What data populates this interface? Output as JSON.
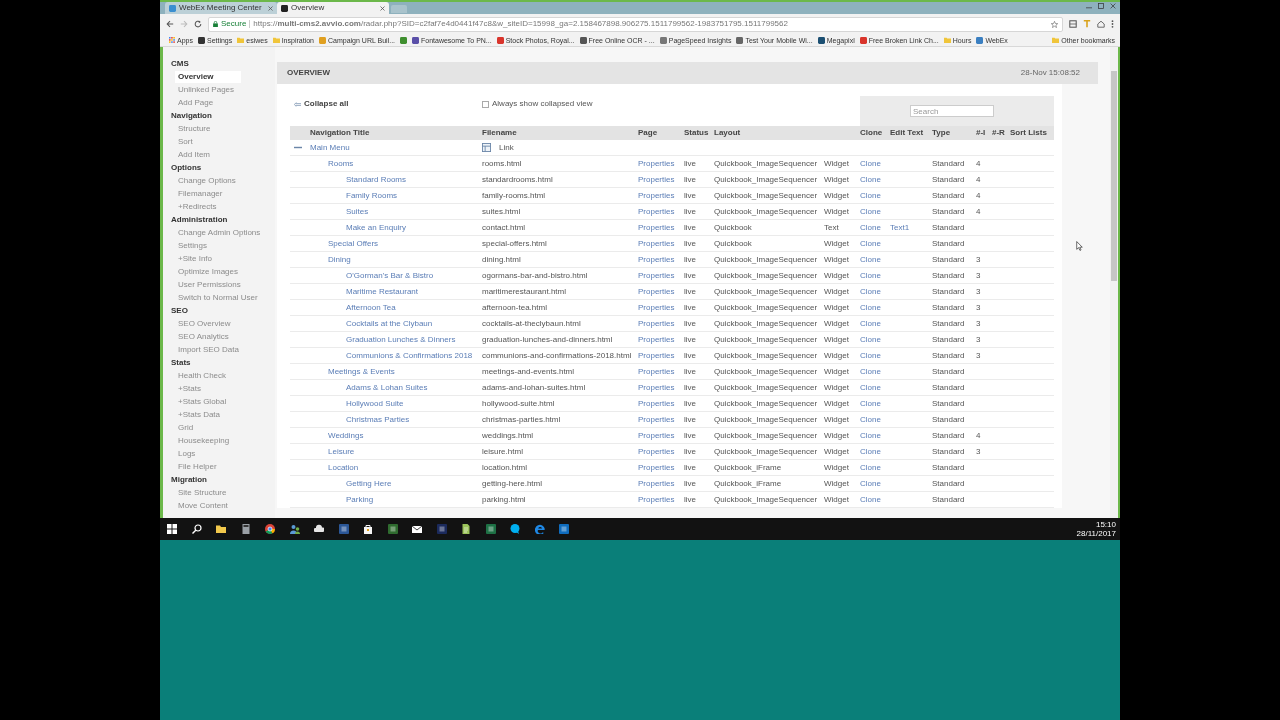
{
  "browser": {
    "tabs": [
      {
        "title": "WebEx Meeting Center",
        "selected": false,
        "color": "#3b8fd0"
      },
      {
        "title": "Overview",
        "selected": true,
        "color": "#222222"
      }
    ],
    "address_bar": {
      "secure_label": "Secure",
      "url": "https://**multi-cms2.avvio.com**/radar.php?SID=c2faf7e4d0441f47c8&w_siteID=15998_ga=2.158467898.906275.1511799562-1983751795.1511799562"
    },
    "bookmarks": [
      {
        "kind": "apps",
        "label": "Apps"
      },
      {
        "kind": "site",
        "label": "Settings",
        "color": "#333333"
      },
      {
        "kind": "folder",
        "label": "esiwes"
      },
      {
        "kind": "folder",
        "label": "Inspiration"
      },
      {
        "kind": "site",
        "label": "Campaign URL Buil...",
        "color": "#e0a020"
      },
      {
        "kind": "site",
        "color": "#3f8f2f"
      },
      {
        "kind": "site",
        "label": "Fontawesome To PN...",
        "color": "#5a4fa8"
      },
      {
        "kind": "site",
        "label": "Stock Photos, Royal...",
        "color": "#d9342b"
      },
      {
        "kind": "site",
        "label": "Free Online OCR - ...",
        "color": "#555555"
      },
      {
        "kind": "site",
        "label": "PageSpeed Insights",
        "color": "#777777"
      },
      {
        "kind": "site",
        "label": "Test Your Mobile Wi...",
        "color": "#666666"
      },
      {
        "kind": "site",
        "label": "Megapixl",
        "color": "#1b4f72"
      },
      {
        "kind": "site",
        "label": "Free Broken Link Ch...",
        "color": "#d9342b"
      },
      {
        "kind": "folder",
        "label": "Hours"
      },
      {
        "kind": "site",
        "label": "WebEx",
        "color": "#3a7fc1"
      }
    ],
    "other_bookmarks": {
      "label": "Other bookmarks"
    }
  },
  "sidebar": {
    "sections": [
      {
        "title": "CMS",
        "items": [
          {
            "label": "Overview",
            "selected": true
          },
          {
            "label": "Unlinked Pages",
            "selected": false
          },
          {
            "label": "Add Page",
            "selected": false
          }
        ]
      },
      {
        "title": "Navigation",
        "items": [
          {
            "label": "Structure",
            "selected": false
          },
          {
            "label": "Sort",
            "selected": false
          },
          {
            "label": "Add Item",
            "selected": false
          }
        ]
      },
      {
        "title": "Options",
        "items": [
          {
            "label": "Change Options",
            "selected": false
          },
          {
            "label": "Filemanager",
            "selected": false
          },
          {
            "label": "+Redirects",
            "selected": false
          }
        ]
      },
      {
        "title": "Administration",
        "items": [
          {
            "label": "Change Admin Options",
            "selected": false
          },
          {
            "label": "Settings",
            "selected": false
          },
          {
            "label": "+Site Info",
            "selected": false
          },
          {
            "label": "Optimize Images",
            "selected": false
          },
          {
            "label": "User Permissions",
            "selected": false
          },
          {
            "label": "Switch to Normal User",
            "selected": false
          }
        ]
      },
      {
        "title": "SEO",
        "items": [
          {
            "label": "SEO Overview",
            "selected": false
          },
          {
            "label": "SEO Analytics",
            "selected": false
          },
          {
            "label": "Import SEO Data",
            "selected": false
          }
        ]
      },
      {
        "title": "Stats",
        "items": [
          {
            "label": "Health Check",
            "selected": false
          },
          {
            "label": "+Stats",
            "selected": false
          },
          {
            "label": "+Stats Global",
            "selected": false
          },
          {
            "label": "+Stats Data",
            "selected": false
          },
          {
            "label": "Grid",
            "selected": false
          },
          {
            "label": "Housekeeping",
            "selected": false
          },
          {
            "label": "Logs",
            "selected": false
          },
          {
            "label": "File Helper",
            "selected": false
          }
        ]
      },
      {
        "title": "Migration",
        "items": [
          {
            "label": "Site Structure",
            "selected": false
          },
          {
            "label": "Move Content",
            "selected": false
          }
        ]
      }
    ]
  },
  "main": {
    "title": "OVERVIEW",
    "timestamp": "28-Nov 15:08:52",
    "collapse_all": "Collapse all",
    "collapsed_view": {
      "label": "Always show collapsed view",
      "checked": false
    },
    "search": {
      "placeholder": "Search"
    }
  },
  "table": {
    "columns": [
      "Navigation Title",
      "Filename",
      "Page",
      "Status",
      "Layout",
      "Clone",
      "Edit Text",
      "Type",
      "#-I",
      "#-R",
      "Sort Lists"
    ],
    "rows": [
      {
        "kind": "link",
        "title": "Main Menu",
        "expanded": true,
        "filename": "Link",
        "children": [
          {
            "title": "Rooms",
            "filename": "rooms.html",
            "page": "Properties",
            "status": "live",
            "layout": "Quickbook_ImageSequencer",
            "column_6": "Widget",
            "clone": "Clone",
            "type": "Standard",
            "hash_i": "4",
            "children": [
              {
                "title": "Standard Rooms",
                "filename": "standardrooms.html",
                "page": "Properties",
                "status": "live",
                "layout": "Quickbook_ImageSequencer",
                "column_6": "Widget",
                "clone": "Clone",
                "type": "Standard",
                "hash_i": "4"
              },
              {
                "title": "Family Rooms",
                "filename": "family-rooms.html",
                "page": "Properties",
                "status": "live",
                "layout": "Quickbook_ImageSequencer",
                "column_6": "Widget",
                "clone": "Clone",
                "type": "Standard",
                "hash_i": "4"
              },
              {
                "title": "Suites",
                "filename": "suites.html",
                "page": "Properties",
                "status": "live",
                "layout": "Quickbook_ImageSequencer",
                "column_6": "Widget",
                "clone": "Clone",
                "type": "Standard",
                "hash_i": "4"
              },
              {
                "title": "Make an Enquiry",
                "filename": "contact.html",
                "page": "Properties",
                "status": "live",
                "layout": "Quickbook",
                "column_6": "Text",
                "clone": "Clone",
                "edit_text": "Text1",
                "type": "Standard"
              }
            ]
          },
          {
            "title": "Special Offers",
            "filename": "special-offers.html",
            "page": "Properties",
            "status": "live",
            "layout": "Quickbook",
            "column_6": "Widget",
            "clone": "Clone",
            "type": "Standard"
          },
          {
            "title": "Dining",
            "filename": "dining.html",
            "page": "Properties",
            "status": "live",
            "layout": "Quickbook_ImageSequencer",
            "column_6": "Widget",
            "clone": "Clone",
            "type": "Standard",
            "hash_i": "3",
            "children": [
              {
                "title": "O'Gorman's Bar & Bistro",
                "filename": "ogormans-bar-and-bistro.html",
                "page": "Properties",
                "status": "live",
                "layout": "Quickbook_ImageSequencer",
                "column_6": "Widget",
                "clone": "Clone",
                "type": "Standard",
                "hash_i": "3"
              },
              {
                "title": "Maritime Restaurant",
                "filename": "maritimerestaurant.html",
                "page": "Properties",
                "status": "live",
                "layout": "Quickbook_ImageSequencer",
                "column_6": "Widget",
                "clone": "Clone",
                "type": "Standard",
                "hash_i": "3"
              },
              {
                "title": "Afternoon Tea",
                "filename": "afternoon-tea.html",
                "page": "Properties",
                "status": "live",
                "layout": "Quickbook_ImageSequencer",
                "column_6": "Widget",
                "clone": "Clone",
                "type": "Standard",
                "hash_i": "3"
              },
              {
                "title": "Cocktails at the Clybaun",
                "filename": "cocktails-at-theclybaun.html",
                "page": "Properties",
                "status": "live",
                "layout": "Quickbook_ImageSequencer",
                "column_6": "Widget",
                "clone": "Clone",
                "type": "Standard",
                "hash_i": "3"
              },
              {
                "title": "Graduation Lunches & Dinners",
                "filename": "graduation-lunches-and-dinners.html",
                "page": "Properties",
                "status": "live",
                "layout": "Quickbook_ImageSequencer",
                "column_6": "Widget",
                "clone": "Clone",
                "type": "Standard",
                "hash_i": "3"
              },
              {
                "title": "Communions & Confirmations 2018",
                "filename": "communions-and-confirmations-2018.html",
                "page": "Properties",
                "status": "live",
                "layout": "Quickbook_ImageSequencer",
                "column_6": "Widget",
                "clone": "Clone",
                "type": "Standard",
                "hash_i": "3"
              }
            ]
          },
          {
            "title": "Meetings & Events",
            "filename": "meetings-and-events.html",
            "page": "Properties",
            "status": "live",
            "layout": "Quickbook_ImageSequencer",
            "column_6": "Widget",
            "clone": "Clone",
            "type": "Standard",
            "children": [
              {
                "title": "Adams & Lohan Suites",
                "filename": "adams-and-lohan-suites.html",
                "page": "Properties",
                "status": "live",
                "layout": "Quickbook_ImageSequencer",
                "column_6": "Widget",
                "clone": "Clone",
                "type": "Standard"
              },
              {
                "title": "Hollywood Suite",
                "filename": "hollywood-suite.html",
                "page": "Properties",
                "status": "live",
                "layout": "Quickbook_ImageSequencer",
                "column_6": "Widget",
                "clone": "Clone",
                "type": "Standard"
              },
              {
                "title": "Christmas Parties",
                "filename": "christmas-parties.html",
                "page": "Properties",
                "status": "live",
                "layout": "Quickbook_ImageSequencer",
                "column_6": "Widget",
                "clone": "Clone",
                "type": "Standard"
              }
            ]
          },
          {
            "title": "Weddings",
            "filename": "weddings.html",
            "page": "Properties",
            "status": "live",
            "layout": "Quickbook_ImageSequencer",
            "column_6": "Widget",
            "clone": "Clone",
            "type": "Standard",
            "hash_i": "4"
          },
          {
            "title": "Leisure",
            "filename": "leisure.html",
            "page": "Properties",
            "status": "live",
            "layout": "Quickbook_ImageSequencer",
            "column_6": "Widget",
            "clone": "Clone",
            "type": "Standard",
            "hash_i": "3"
          },
          {
            "title": "Location",
            "filename": "location.html",
            "page": "Properties",
            "status": "live",
            "layout": "Quickbook_iFrame",
            "column_6": "Widget",
            "clone": "Clone",
            "type": "Standard",
            "children": [
              {
                "title": "Getting Here",
                "filename": "getting-here.html",
                "page": "Properties",
                "status": "live",
                "layout": "Quickbook_iFrame",
                "column_6": "Widget",
                "clone": "Clone",
                "type": "Standard"
              },
              {
                "title": "Parking",
                "filename": "parking.html",
                "page": "Properties",
                "status": "live",
                "layout": "Quickbook_ImageSequencer",
                "column_6": "Widget",
                "clone": "Clone",
                "type": "Standard"
              }
            ]
          }
        ]
      }
    ]
  },
  "taskbar": {
    "time": "15:10",
    "date": "28/11/2017"
  }
}
